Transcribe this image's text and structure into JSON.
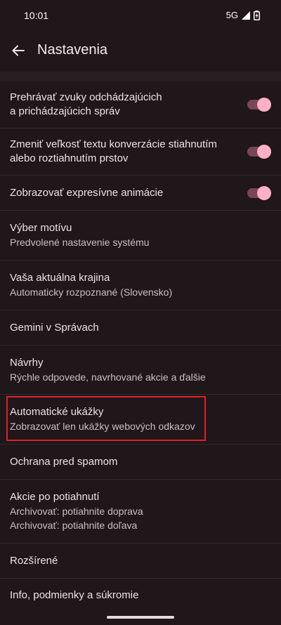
{
  "status": {
    "time": "10:01",
    "network": "5G"
  },
  "header": {
    "title": "Nastavenia"
  },
  "settings": [
    {
      "title": "Prehrávať zvuky odchádzajúcich\na prichádzajúcich správ",
      "toggle": true
    },
    {
      "title": "Zmeniť veľkosť textu konverzácie stiahnutím alebo roztiahnutím prstov",
      "toggle": true
    },
    {
      "title": "Zobrazovať expresívne animácie",
      "toggle": true
    },
    {
      "title": "Výber motívu",
      "subtitle": "Predvolené nastavenie systému"
    },
    {
      "title": "Vaša aktuálna krajina",
      "subtitle": "Automaticky rozpoznané (Slovensko)"
    },
    {
      "title": "Gemini v Správach"
    },
    {
      "title": "Návrhy",
      "subtitle": "Rýchle odpovede, navrhované akcie a ďalšie"
    },
    {
      "title": "Automatické ukážky",
      "subtitle": "Zobrazovať len ukážky webových odkazov"
    },
    {
      "title": "Ochrana pred spamom"
    },
    {
      "title": "Akcie po potiahnutí",
      "subtitle": "Archivovať: potiahnite doprava",
      "subtitle2": "Archivovať: potiahnite doľava"
    },
    {
      "title": "Rozšírené"
    },
    {
      "title": "Info, podmienky a súkromie"
    }
  ]
}
